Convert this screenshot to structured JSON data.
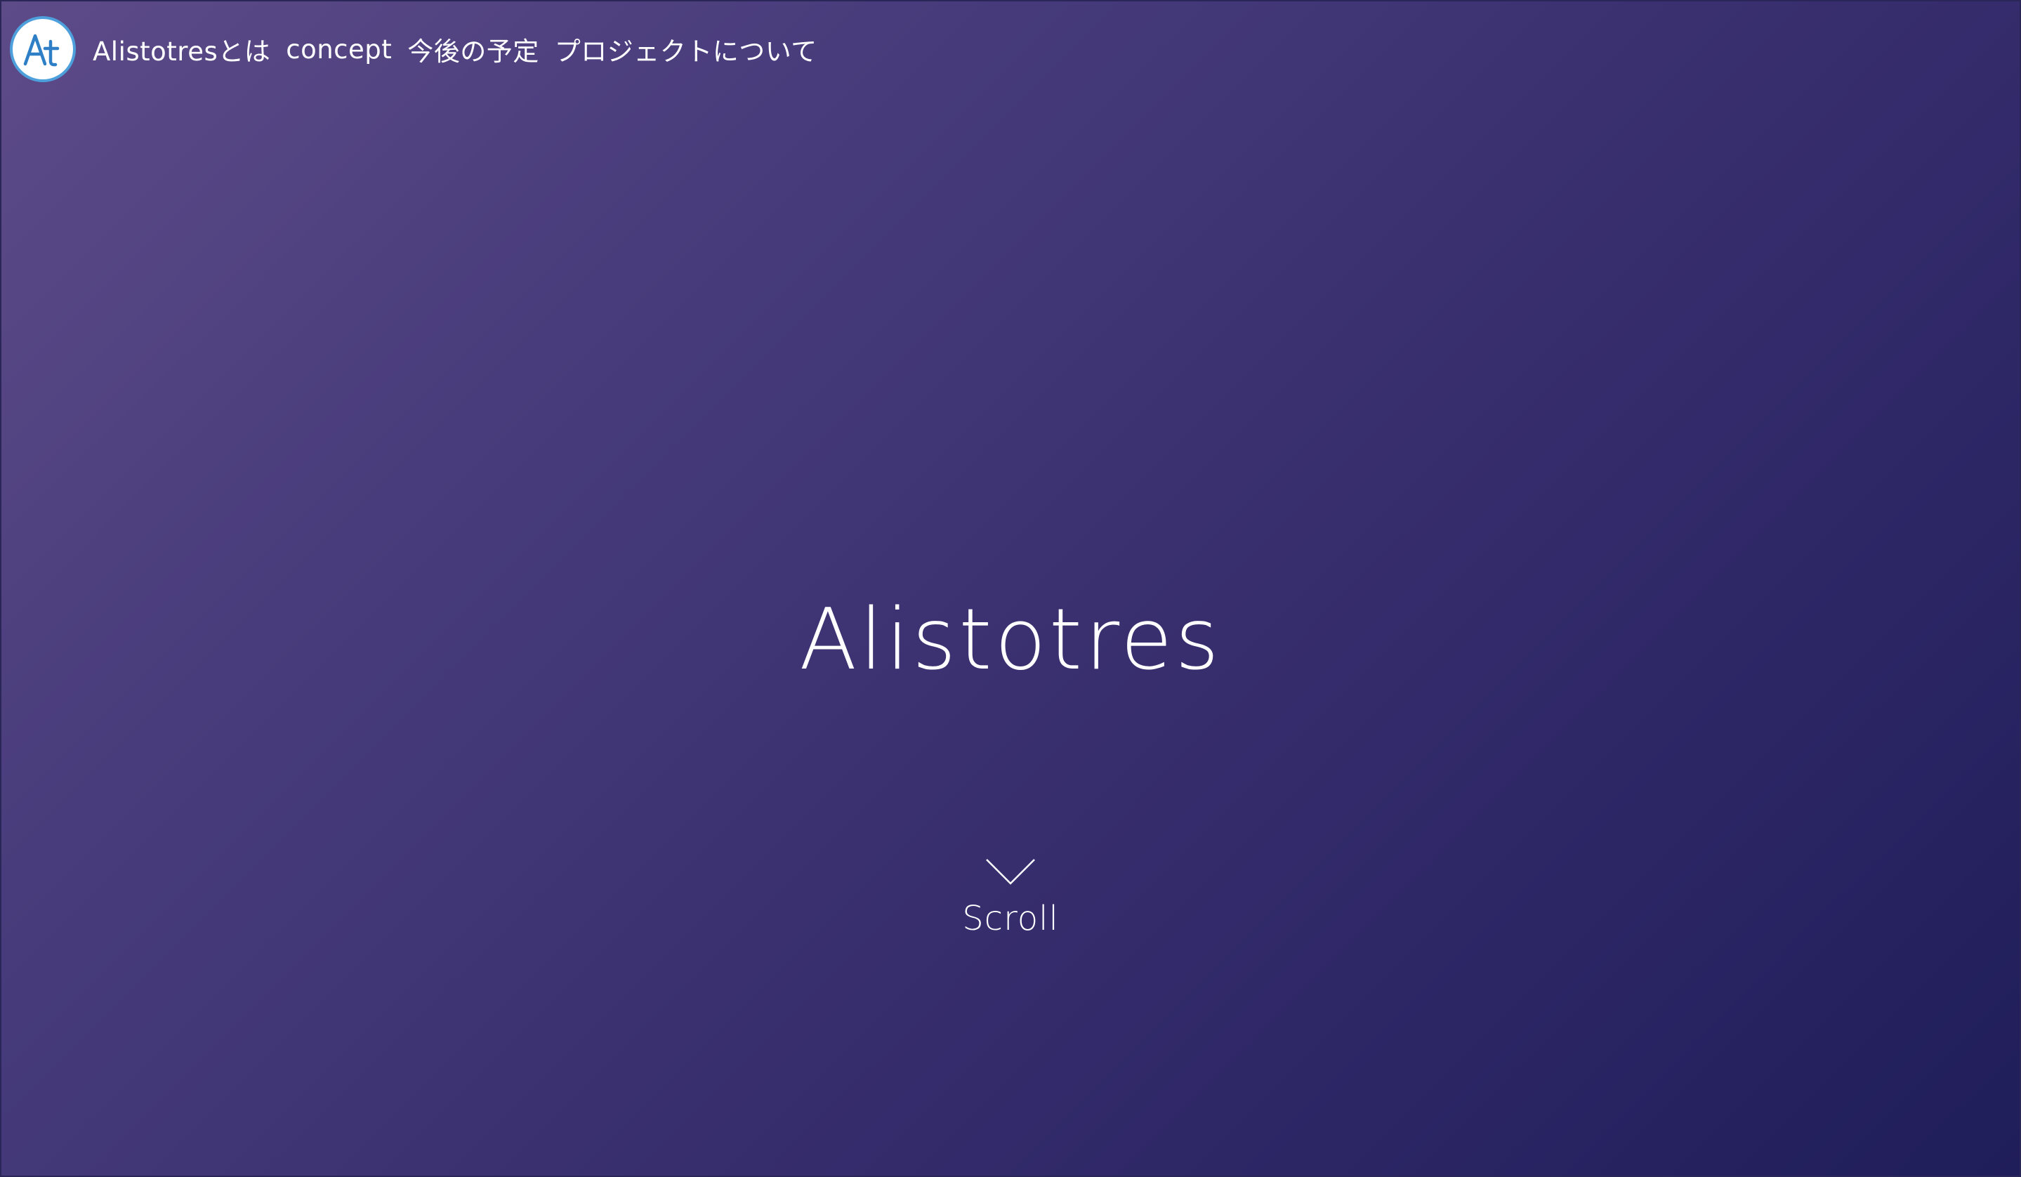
{
  "logo": {
    "text": "At",
    "icon": "brand-logo-icon",
    "colors": {
      "letter": "#2f7fc6",
      "ring": "#4da0dc",
      "background": "#ffffff"
    }
  },
  "nav": {
    "items": [
      {
        "label": "Alistotresとは"
      },
      {
        "label": "concept"
      },
      {
        "label": "今後の予定"
      },
      {
        "label": "プロジェクトについて"
      }
    ]
  },
  "hero": {
    "title": "Alistotres"
  },
  "scroll": {
    "label": "Scroll",
    "icon": "chevron-down-icon"
  },
  "theme": {
    "gradient_start": "#5d4b88",
    "gradient_end": "#1f1d5a",
    "text": "#ffffff"
  }
}
